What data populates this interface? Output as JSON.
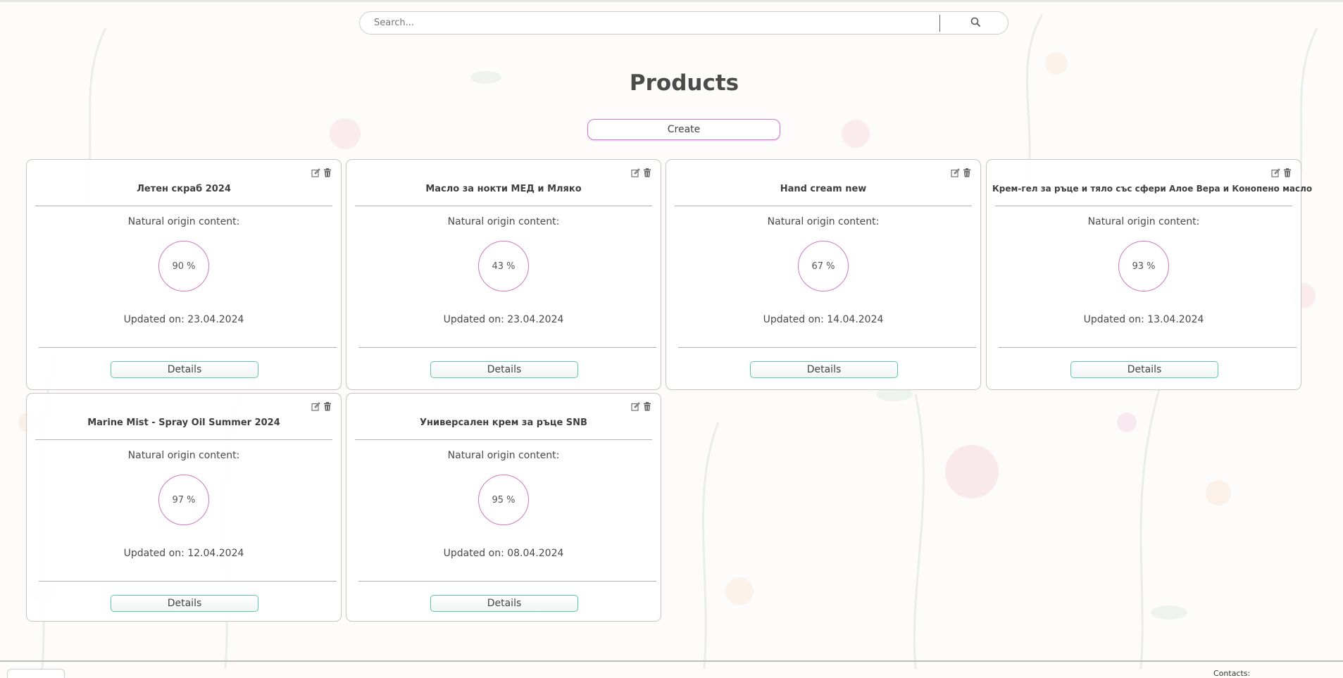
{
  "search": {
    "placeholder": "Search...",
    "icon": "search-icon"
  },
  "page": {
    "title": "Products",
    "create_label": "Create"
  },
  "products": [
    {
      "name": "Летен скраб 2024",
      "natural_label": "Natural origin content:",
      "percent_text": "90 %",
      "updated": "Updated on: 23.04.2024",
      "details_label": "Details"
    },
    {
      "name": "Масло за нокти МЕД и Мляко",
      "natural_label": "Natural origin content:",
      "percent_text": "43 %",
      "updated": "Updated on: 23.04.2024",
      "details_label": "Details"
    },
    {
      "name": "Hand cream new",
      "natural_label": "Natural origin content:",
      "percent_text": "67 %",
      "updated": "Updated on: 14.04.2024",
      "details_label": "Details"
    },
    {
      "name": "Крем-гел за ръце и тяло със сфери Алое Вера и Конопено масло",
      "natural_label": "Natural origin content:",
      "percent_text": "93 %",
      "updated": "Updated on: 13.04.2024",
      "details_label": "Details"
    },
    {
      "name": "Marine Mist - Spray Oil Summer 2024",
      "natural_label": "Natural origin content:",
      "percent_text": "97 %",
      "updated": "Updated on: 12.04.2024",
      "details_label": "Details"
    },
    {
      "name": "Универсален крем за ръце SNB",
      "natural_label": "Natural origin content:",
      "percent_text": "95 %",
      "updated": "Updated on: 08.04.2024",
      "details_label": "Details"
    }
  ],
  "footer": {
    "contacts_label": "Contacts:"
  },
  "colors": {
    "accent_pink": "#d07ad4",
    "details_border": "#5fc9b0",
    "text": "#4a4a4a"
  }
}
